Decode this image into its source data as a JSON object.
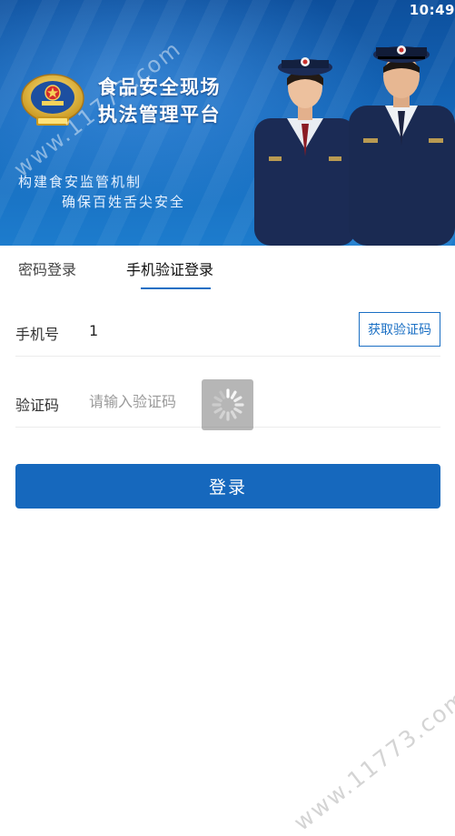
{
  "status_bar": {
    "time": "10:49"
  },
  "banner": {
    "title_line1": "食品安全现场",
    "title_line2": "执法管理平台",
    "slogan_line1": "构建食安监管机制",
    "slogan_line2": "确保百姓舌尖安全",
    "watermark": "www.11773.com"
  },
  "tabs": {
    "password_login": "密码登录",
    "sms_login": "手机验证登录",
    "active": "sms_login"
  },
  "form": {
    "phone_label": "手机号",
    "phone_value": "1",
    "get_code_label": "获取验证码",
    "code_label": "验证码",
    "code_placeholder": "请输入验证码"
  },
  "login_button": "登录",
  "watermark_bottom": "www.11773.com",
  "colors": {
    "accent": "#1a6fc4",
    "banner_blue": "#1466b8",
    "login_button": "#1668bd"
  },
  "icons": [
    "national-emblem-icon",
    "loading-spinner-icon"
  ]
}
